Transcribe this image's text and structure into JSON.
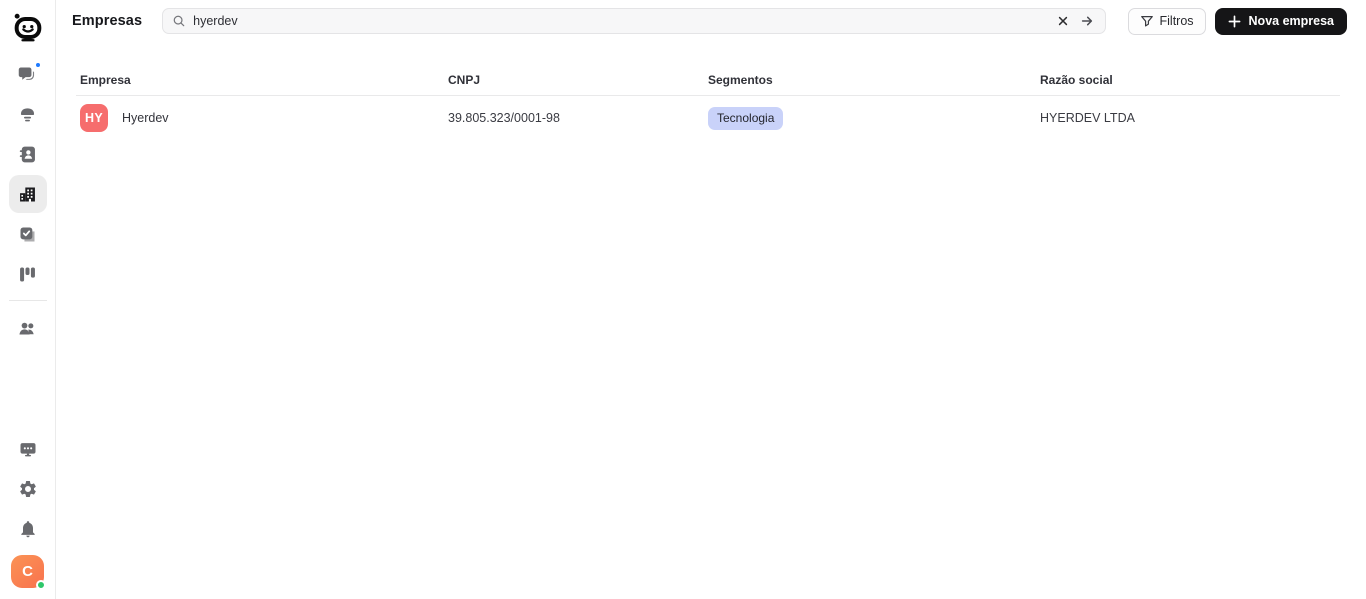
{
  "header": {
    "title": "Empresas",
    "search": {
      "value": "hyerdev",
      "placeholder": ""
    },
    "filters_label": "Filtros",
    "new_company_label": "Nova empresa"
  },
  "table": {
    "columns": [
      "Empresa",
      "CNPJ",
      "Segmentos",
      "Razão social"
    ],
    "rows": [
      {
        "initials": "HY",
        "name": "Hyerdev",
        "cnpj": "39.805.323/0001-98",
        "segments": [
          "Tecnologia"
        ],
        "razao_social": "HYERDEV LTDA"
      }
    ]
  },
  "sidebar": {
    "active_item": "companies",
    "items": [
      "chat",
      "lamp",
      "contacts",
      "companies",
      "tasks",
      "kanban",
      "team"
    ],
    "bottom_items": [
      "wallboard",
      "settings",
      "notifications"
    ],
    "avatar_initial": "C",
    "avatar_status": "online",
    "chat_has_notification": true
  },
  "colors": {
    "segment_badge_bg": "#c9d2f9",
    "company_avatar_bg": "#f66d6d",
    "user_avatar_bg": "#f8724e",
    "online_dot": "#2fc76a",
    "notification_dot": "#1f7bff",
    "primary_button_bg": "#151517",
    "sidebar_active_bg": "#ececec"
  }
}
